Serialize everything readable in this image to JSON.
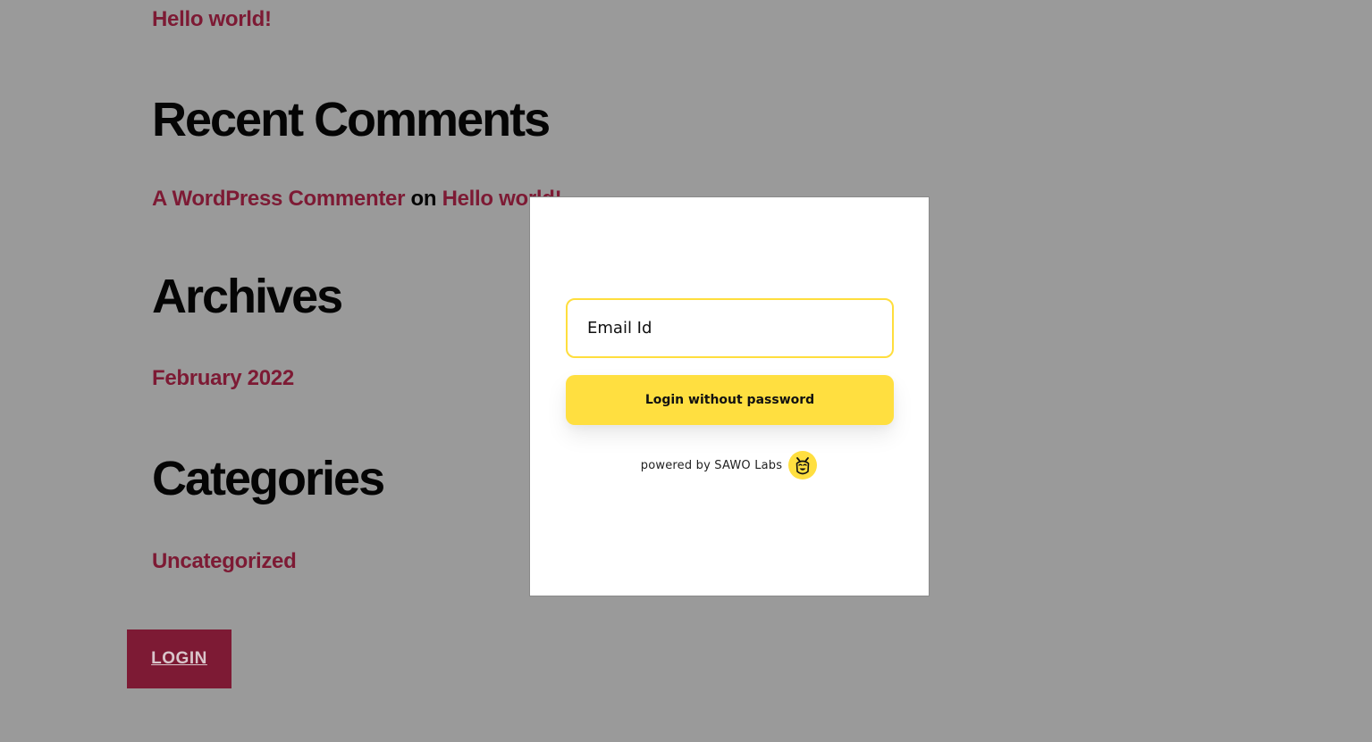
{
  "page": {
    "post_link": "Hello world!",
    "recent_comments": {
      "title": "Recent Comments",
      "author": "A WordPress Commenter",
      "connector": "on",
      "post": "Hello world!"
    },
    "archives": {
      "title": "Archives",
      "item": "February 2022"
    },
    "categories": {
      "title": "Categories",
      "item": "Uncategorized"
    },
    "login_button": "LOGIN"
  },
  "modal": {
    "email_placeholder": "Email Id",
    "submit_label": "Login without password",
    "powered_by": "powered by SAWO Labs",
    "logo_icon": "sawo-bee-logo-icon"
  },
  "colors": {
    "overlay_background": "#9a9a9a",
    "link": "#7d1a34",
    "accent_yellow": "#ffdf40",
    "modal_background": "#ffffff"
  }
}
